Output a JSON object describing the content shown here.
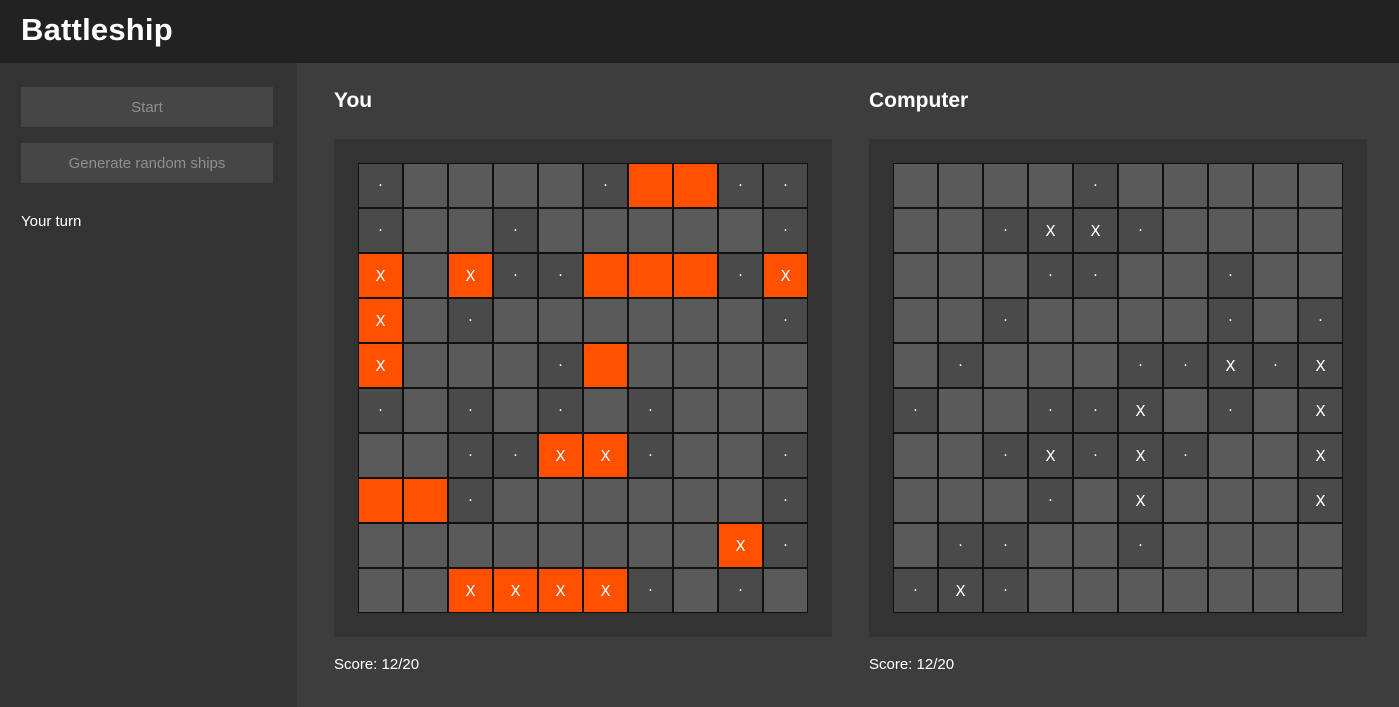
{
  "app": {
    "title": "Battleship"
  },
  "sidebar": {
    "start_label": "Start",
    "random_label": "Generate random ships",
    "status": "Your turn"
  },
  "colors": {
    "ship": "#ff5000",
    "cell": "#5a5a5a",
    "shot_cell": "#4a4a4a",
    "panel": "#333333"
  },
  "legend": {
    "ship": "S",
    "hit": "X",
    "miss": "."
  },
  "boards": {
    "player": {
      "title": "You",
      "score": "Score: 12/20",
      "rows": [
        ".    .SS..",
        ".  .     .",
        "X X..SSS.X",
        "X .      .",
        "X   .S    ",
        ". . . .   ",
        "  ..XX.  .",
        "SS.      .",
        "        X.",
        "  XXXX. . "
      ]
    },
    "computer": {
      "title": "Computer",
      "score": "Score: 12/20",
      "rows": [
        "    .     ",
        "  .XX.    ",
        "   ..  .  ",
        "  .    . .",
        " .   ..X.X",
        ".  ..X . X",
        "  .X.X.  X",
        "   . X   X",
        " ..  .    ",
        ".X.       "
      ]
    }
  }
}
